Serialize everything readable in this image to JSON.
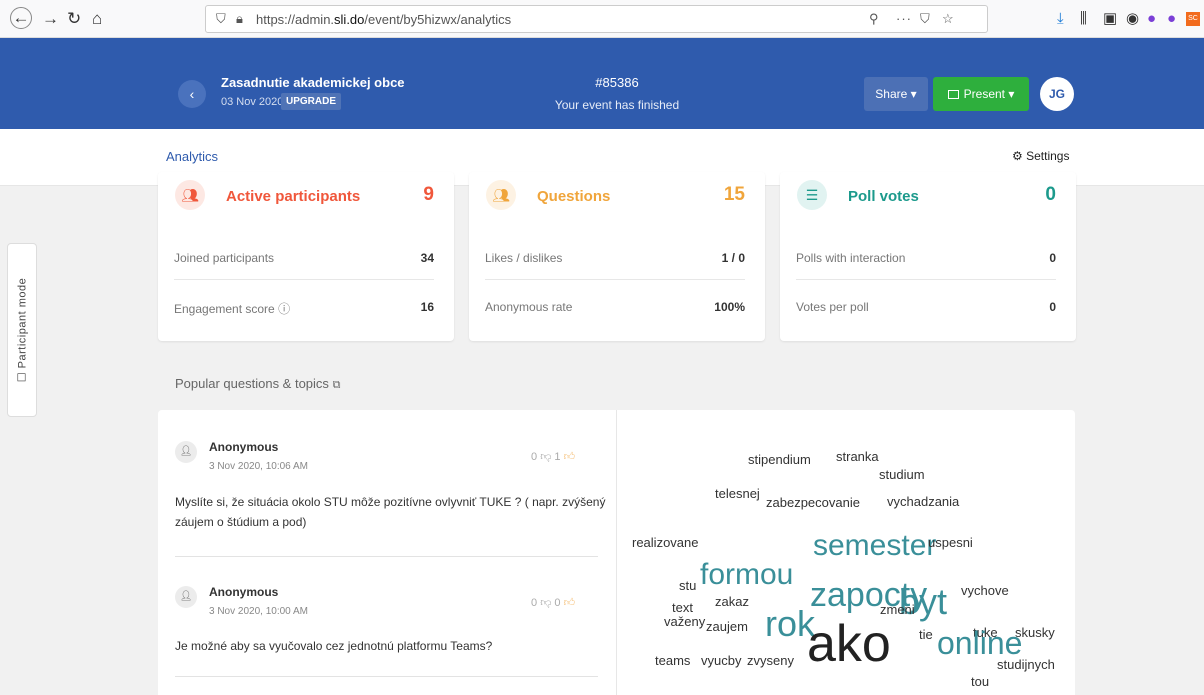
{
  "browser": {
    "url_prefix": "https://admin.",
    "url_domain": "sli.do",
    "url_path": "/event/by5hizwx/analytics"
  },
  "header": {
    "event_title": "Zasadnutie akademickej obce",
    "event_date": "03 Nov 2020",
    "upgrade_label": "UPGRADE",
    "event_code": "#85386",
    "event_status": "Your event has finished",
    "share_label": "Share ▾",
    "present_label": "Present ▾",
    "avatar_initials": "JG"
  },
  "subnav": {
    "analytics_label": "Analytics",
    "settings_label": "Settings"
  },
  "side_tab": {
    "label": "Participant mode"
  },
  "cards": [
    {
      "title": "Active participants",
      "number": "9",
      "color": "#f0573b",
      "icon_bg": "#fde8e3",
      "row1_label": "Joined participants",
      "row1_value": "34",
      "row2_label": "Engagement score ⓘ",
      "row2_value": "16"
    },
    {
      "title": "Questions",
      "number": "15",
      "color": "#f0a53b",
      "icon_bg": "#fdf2e3",
      "row1_label": "Likes / dislikes",
      "row1_value": "1 / 0",
      "row2_label": "Anonymous rate",
      "row2_value": "100%"
    },
    {
      "title": "Poll votes",
      "number": "0",
      "color": "#1c9a8c",
      "icon_bg": "#e1f3f1",
      "row1_label": "Polls with interaction",
      "row1_value": "0",
      "row2_label": "Votes per poll",
      "row2_value": "0"
    }
  ],
  "popular": {
    "title": "Popular questions & topics"
  },
  "questions": [
    {
      "author": "Anonymous",
      "time": "3 Nov 2020, 10:06 AM",
      "dislikes": "0",
      "likes": "1",
      "text_line1": "Myslíte si, že situácia okolo STU môže pozitívne ovlyvniť TUKE ? ( napr. zvýšený",
      "text_line2": "záujem o štúdium a pod)"
    },
    {
      "author": "Anonymous",
      "time": "3 Nov 2020, 10:00 AM",
      "dislikes": "0",
      "likes": "0",
      "text_line1": "Je možné aby sa vyučovalo cez jednotnú platformu Teams?",
      "text_line2": ""
    }
  ],
  "word_cloud": [
    {
      "text": "stipendium",
      "size": 13,
      "color": "#333"
    },
    {
      "text": "stranka",
      "size": 13,
      "color": "#333"
    },
    {
      "text": "studium",
      "size": 13,
      "color": "#333"
    },
    {
      "text": "telesnej",
      "size": 13,
      "color": "#333"
    },
    {
      "text": "zabezpecovanie",
      "size": 13,
      "color": "#333"
    },
    {
      "text": "vychadzania",
      "size": 13,
      "color": "#333"
    },
    {
      "text": "realizovane",
      "size": 13,
      "color": "#333"
    },
    {
      "text": "semester",
      "size": 30,
      "color": "#3a8f99"
    },
    {
      "text": "uspesni",
      "size": 13,
      "color": "#333"
    },
    {
      "text": "formou",
      "size": 30,
      "color": "#3a8f99"
    },
    {
      "text": "stu",
      "size": 13,
      "color": "#333"
    },
    {
      "text": "zapocty",
      "size": 34,
      "color": "#3a8f99"
    },
    {
      "text": "vychove",
      "size": 13,
      "color": "#333"
    },
    {
      "text": "byt",
      "size": 36,
      "color": "#3a8f99"
    },
    {
      "text": "zakaz",
      "size": 13,
      "color": "#333"
    },
    {
      "text": "text",
      "size": 13,
      "color": "#333"
    },
    {
      "text": "rok",
      "size": 36,
      "color": "#3a8f99"
    },
    {
      "text": "zmeni",
      "size": 13,
      "color": "#333"
    },
    {
      "text": "tuke",
      "size": 13,
      "color": "#333"
    },
    {
      "text": "skusky",
      "size": 13,
      "color": "#333"
    },
    {
      "text": "važeny",
      "size": 13,
      "color": "#333"
    },
    {
      "text": "zaujem",
      "size": 13,
      "color": "#333"
    },
    {
      "text": "ako",
      "size": 52,
      "color": "#222"
    },
    {
      "text": "tie",
      "size": 13,
      "color": "#333"
    },
    {
      "text": "online",
      "size": 32,
      "color": "#3a8f99"
    },
    {
      "text": "teams",
      "size": 13,
      "color": "#333"
    },
    {
      "text": "vyucby",
      "size": 13,
      "color": "#333"
    },
    {
      "text": "zvyseny",
      "size": 13,
      "color": "#333"
    },
    {
      "text": "studijnych",
      "size": 13,
      "color": "#333"
    },
    {
      "text": "tou",
      "size": 13,
      "color": "#333"
    }
  ]
}
